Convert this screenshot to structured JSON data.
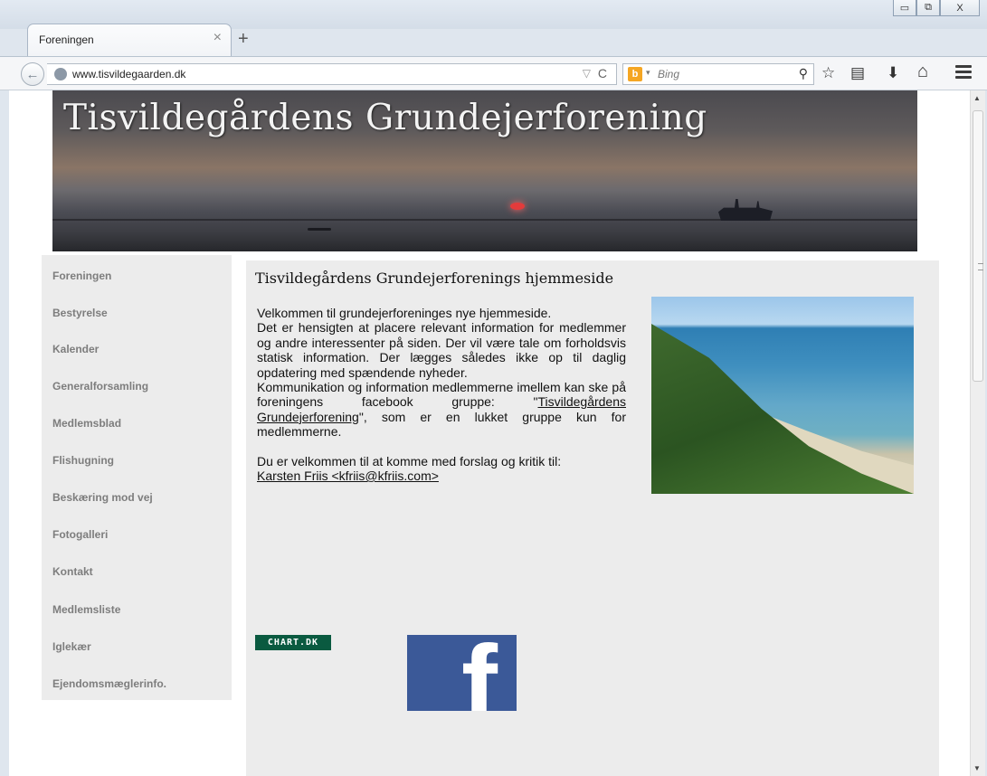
{
  "browser": {
    "tab_title": "Foreningen",
    "tab_close": "×",
    "new_tab": "+",
    "url": "www.tisvildegaarden.dk",
    "url_dropdown": "▽",
    "url_reload": "C",
    "search_placeholder": "Bing",
    "search_engine_glyph": "b",
    "search_dropdown": "▾",
    "search_icon": "⚲",
    "bookmark_star": "☆",
    "reading_list": "▤",
    "download": "⬇",
    "home": "⌂",
    "back": "←",
    "win_minimize": "▭",
    "win_maximize": "⧉",
    "win_close": "X"
  },
  "banner": {
    "title": "Tisvildegårdens Grundejerforening"
  },
  "sidebar": {
    "items": [
      {
        "label": "Foreningen"
      },
      {
        "label": "Bestyrelse"
      },
      {
        "label": "Kalender"
      },
      {
        "label": "Generalforsamling"
      },
      {
        "label": "Medlemsblad"
      },
      {
        "label": "Flishugning"
      },
      {
        "label": "Beskæring mod vej"
      },
      {
        "label": "Fotogalleri"
      },
      {
        "label": "Kontakt"
      },
      {
        "label": "Medlemsliste"
      },
      {
        "label": "Iglekær"
      },
      {
        "label": "Ejendomsmæglerinfo."
      }
    ]
  },
  "content": {
    "title": "Tisvildegårdens Grundejerforenings hjemmeside",
    "p1": "Velkommen til grundejerforeninges nye hjemmeside.",
    "p2": "Det er hensigten at placere relevant information for medlemmer og andre interessenter på siden. Der vil være tale om forholdsvis statisk information. Der lægges således ikke op til daglig opdatering med spændende nyheder.",
    "p3_before": "Kommunikation og information medlemmerne imellem kan ske på foreningens facebook gruppe: \"",
    "p3_link": "Tisvildegårdens Grundejerforening",
    "p3_after": "\", som er en lukket gruppe kun for medlemmerne.",
    "p4": "Du er velkommen til at komme med forslag og kritik til:",
    "contact_link": "Karsten Friis <kfriis@kfriis.com>",
    "chart_badge": "CHART.DK",
    "facebook_glyph": "f"
  }
}
